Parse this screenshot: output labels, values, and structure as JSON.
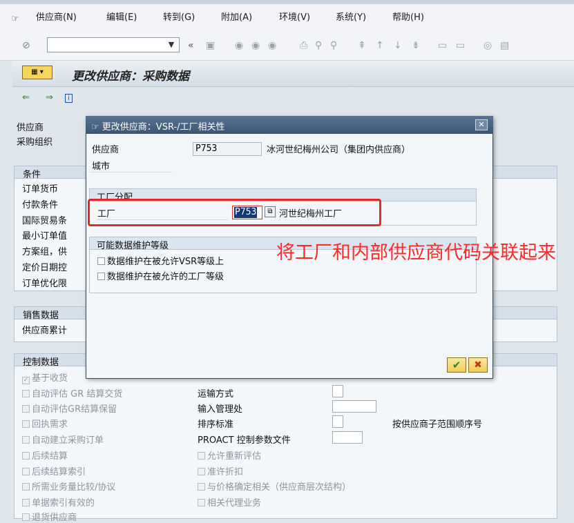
{
  "menu": {
    "items": [
      {
        "label": "供应商(N)"
      },
      {
        "label": "编辑(E)"
      },
      {
        "label": "转到(G)"
      },
      {
        "label": "附加(A)"
      },
      {
        "label": "环境(V)"
      },
      {
        "label": "系统(Y)"
      },
      {
        "label": "帮助(H)"
      }
    ]
  },
  "toolbar": {
    "command_value": ""
  },
  "title": {
    "text": "更改供应商：采购数据"
  },
  "header": {
    "vendor_label": "供应商",
    "purch_org_label": "采购组织"
  },
  "conditions": {
    "title": "条件",
    "rows": [
      "订单货币",
      "付款条件",
      "国际贸易条",
      "最小订单值",
      "方案组，供",
      "定价日期控",
      "订单优化限"
    ]
  },
  "sales": {
    "title": "销售数据",
    "rows": [
      "供应商累计"
    ]
  },
  "control": {
    "title": "控制数据",
    "left": [
      "基于收货",
      "自动评估 GR 结算交货",
      "自动评估GR结算保留",
      "回执需求",
      "自动建立采购订单",
      "后续结算",
      "后续结算索引",
      "所需业务量比较/协议",
      "单据索引有效的",
      "退货供应商"
    ],
    "mid_fields": [
      "运输方式",
      "输入管理处",
      "排序标准",
      "PROACT 控制参数文件"
    ],
    "mid_checks": [
      "允许重新评估",
      "准许折扣",
      "与价格确定相关（供应商层次结构）",
      "相关代理业务"
    ],
    "sort_note": "按供应商子范围顺序号"
  },
  "dialog": {
    "title": "更改供应商：VSR-/工厂相关性",
    "vendor_label": "供应商",
    "vendor_code": "P753",
    "vendor_name": "冰河世纪梅州公司（集团内供应商）",
    "city_label": "城市",
    "plant_section_title": "工厂分配",
    "plant_label": "工厂",
    "plant_value": "P753",
    "plant_name": "河世纪梅州工厂",
    "maint_section_title": "可能数据维护等级",
    "maint_options": [
      "数据维护在被允许VSR等级上",
      "数据维护在被允许的工厂等级"
    ]
  },
  "annotation": {
    "text": "将工厂和内部供应商代码关联起来"
  },
  "colors": {
    "annotation": "#ff2a2a",
    "dialog_title": "#3b5573",
    "highlight": "#e8252b"
  }
}
